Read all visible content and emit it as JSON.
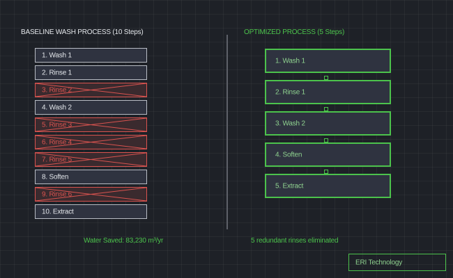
{
  "baseline": {
    "title": "BASELINE WASH PROCESS (10 Steps)",
    "steps": [
      {
        "label": "1. Wash 1",
        "eliminated": false
      },
      {
        "label": "2. Rinse 1",
        "eliminated": false
      },
      {
        "label": "3. Rinse 2",
        "eliminated": true
      },
      {
        "label": "4. Wash 2",
        "eliminated": false
      },
      {
        "label": "5. Rinse 3",
        "eliminated": true
      },
      {
        "label": "6. Rinse 4",
        "eliminated": true
      },
      {
        "label": "7. Rinse 5",
        "eliminated": true
      },
      {
        "label": "8. Soften",
        "eliminated": false
      },
      {
        "label": "9. Rinse 6",
        "eliminated": true
      },
      {
        "label": "10. Extract",
        "eliminated": false
      }
    ]
  },
  "optimized": {
    "title": "OPTIMIZED PROCESS (5 Steps)",
    "steps": [
      {
        "label": "1. Wash 1"
      },
      {
        "label": "2. Rinse 1"
      },
      {
        "label": "3. Wash 2"
      },
      {
        "label": "4. Soften"
      },
      {
        "label": "5. Extract"
      }
    ]
  },
  "footer": {
    "water_saved": "Water Saved: 83,230 m³/yr",
    "rinses_eliminated": "5 redundant rinses eliminated",
    "brand": "ERI Technology"
  },
  "colors": {
    "background": "#1e2127",
    "kept_border": "#b8bcc4",
    "eliminated": "#d9534f",
    "optimized": "#4cc34c"
  }
}
